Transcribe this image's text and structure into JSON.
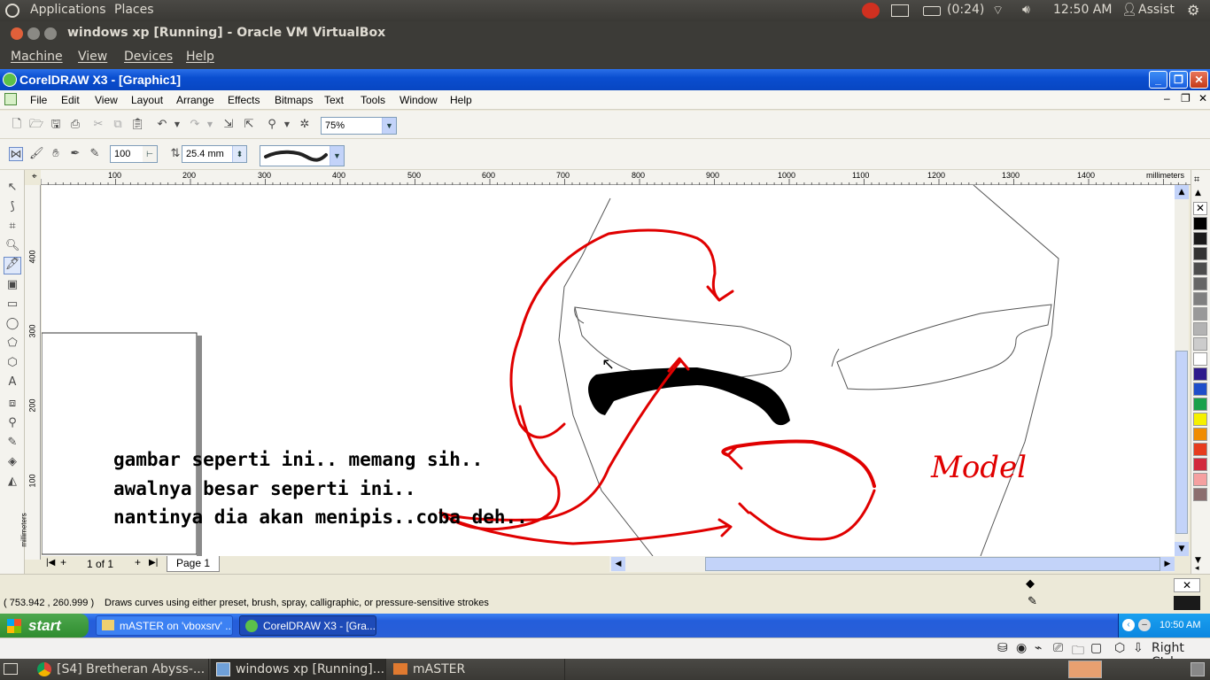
{
  "top_panel": {
    "applications": "Applications",
    "places": "Places",
    "battery": "(0:24)",
    "clock": "12:50 AM",
    "user": "Assist"
  },
  "vbox": {
    "title": "windows xp [Running] - Oracle VM VirtualBox",
    "menu": [
      "Machine",
      "View",
      "Devices",
      "Help"
    ],
    "host_key": "Right Ctrl"
  },
  "corel": {
    "title": "CorelDRAW X3 - [Graphic1]",
    "menu": [
      "File",
      "Edit",
      "View",
      "Layout",
      "Arrange",
      "Effects",
      "Bitmaps",
      "Text",
      "Tools",
      "Window",
      "Help"
    ],
    "zoom": "75%",
    "brush_width": "100",
    "size_value": "25.4 mm",
    "ruler_unit": "millimeters",
    "h_ticks": [
      "100",
      "200",
      "300",
      "400",
      "500",
      "600",
      "700",
      "800",
      "900",
      "1000",
      "1100",
      "1200",
      "1300",
      "1400"
    ],
    "v_ticks": [
      "400",
      "300",
      "200",
      "100"
    ],
    "page_count": "1 of 1",
    "page_tab": "Page 1",
    "coords": "( 753.942 , 260.999 )",
    "status_hint": "Draws curves using either preset, brush, spray, calligraphic, or pressure-sensitive strokes",
    "canvas_text": [
      "gambar seperti ini.. memang sih..",
      "awalnya besar seperti ini..",
      "nantinya dia akan menipis..coba deh.."
    ],
    "canvas_label": "Model",
    "palette": [
      "#ffffff",
      "#000000",
      "#1a1a1a",
      "#333333",
      "#4d4d4d",
      "#666666",
      "#808080",
      "#999999",
      "#b3b3b3",
      "#cccccc",
      "#ffffff",
      "#2e1a8c",
      "#1f4ec9",
      "#1aa04a",
      "#f5f000",
      "#f08c00",
      "#e63c1e",
      "#d2283c",
      "#f5a0a0",
      "#8c6e6e"
    ]
  },
  "xp_taskbar": {
    "start": "start",
    "tasks": [
      "mASTER on 'vboxsrv' ...",
      "CorelDRAW X3 - [Gra..."
    ],
    "clock": "10:50 AM"
  },
  "bottom_panel": {
    "tasks": [
      "[S4] Bretheran Abyss-...",
      "windows xp [Running]...",
      "mASTER"
    ]
  }
}
